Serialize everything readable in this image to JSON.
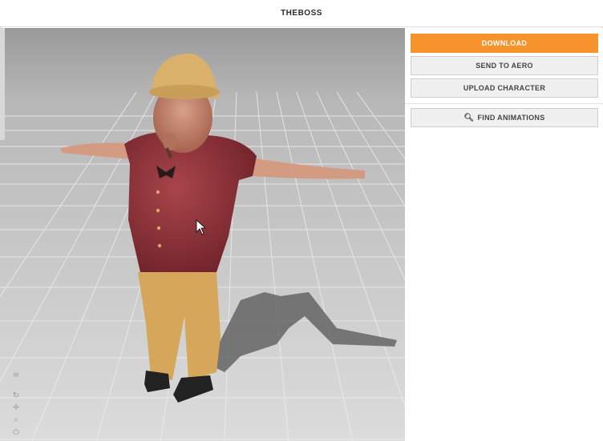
{
  "window": {
    "title": "THEBOSS"
  },
  "sidebar": {
    "download_label": "DOWNLOAD",
    "send_label": "SEND TO AERO",
    "upload_label": "UPLOAD CHARACTER",
    "find_label": "FIND ANIMATIONS"
  },
  "viewport": {
    "tools": [
      "skull-icon",
      "rotate-icon",
      "pan-icon",
      "zoom-icon",
      "power-icon"
    ]
  },
  "colors": {
    "accent": "#f7932d",
    "button_bg": "#f0f0f0",
    "vest": "#8a2e34",
    "pants": "#d6a75a",
    "hat": "#d9b16a"
  }
}
